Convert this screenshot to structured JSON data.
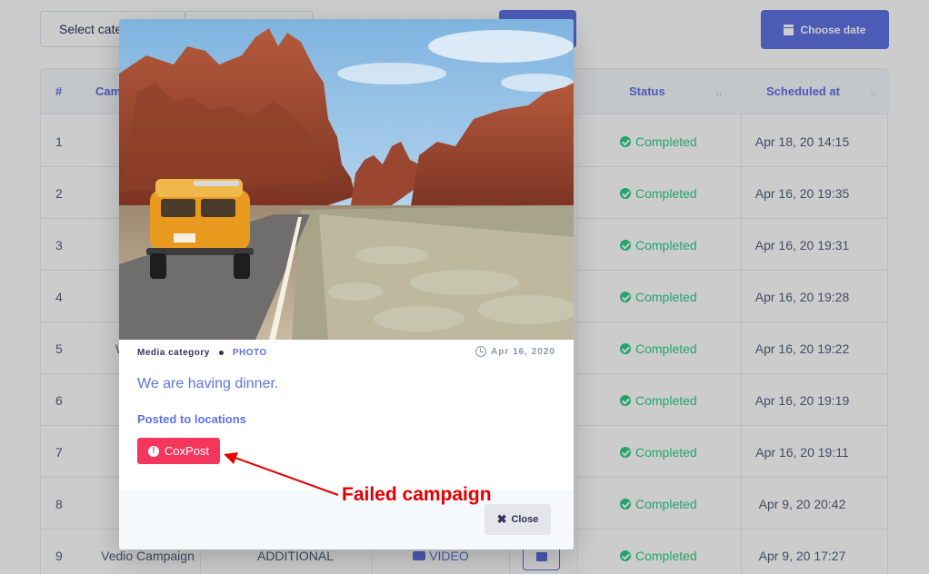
{
  "toolbar": {
    "category_select_value": "Select category",
    "choose_date_label": "Choose date"
  },
  "table": {
    "headers": {
      "num": "#",
      "campaign": "Cam",
      "status": "Status",
      "scheduled": "Scheduled at"
    },
    "rows": [
      {
        "num": "1",
        "status": "Completed",
        "scheduled": "Apr 18, 20 14:15"
      },
      {
        "num": "2",
        "status": "Completed",
        "scheduled": "Apr 16, 20 19:35"
      },
      {
        "num": "3",
        "status": "Completed",
        "scheduled": "Apr 16, 20 19:31"
      },
      {
        "num": "4",
        "status": "Completed",
        "scheduled": "Apr 16, 20 19:28"
      },
      {
        "num": "5",
        "status": "Completed",
        "scheduled": "Apr 16, 20 19:22"
      },
      {
        "num": "6",
        "status": "Completed",
        "scheduled": "Apr 16, 20 19:19"
      },
      {
        "num": "7",
        "status": "Completed",
        "scheduled": "Apr 16, 20 19:11"
      },
      {
        "num": "8",
        "status": "Completed",
        "scheduled": "Apr 9, 20 20:42"
      },
      {
        "num": "9",
        "status": "Completed",
        "scheduled": "Apr 9, 20 17:27",
        "campaign": "Vedio Campaign",
        "type": "ADDITIONAL",
        "media": "VIDEO"
      }
    ],
    "row5_partial": "W"
  },
  "modal": {
    "media_category_label": "Media category",
    "media_type": "PHOTO",
    "date": "Apr 16, 2020",
    "post_text": "We are having dinner.",
    "posted_label": "Posted to locations",
    "location": "CoxPost",
    "close_label": "Close"
  },
  "annotation": {
    "text": "Failed campaign",
    "color": "#e30000"
  },
  "colors": {
    "primary": "#5e72e4",
    "success": "#2dce89",
    "danger": "#f5365c"
  }
}
